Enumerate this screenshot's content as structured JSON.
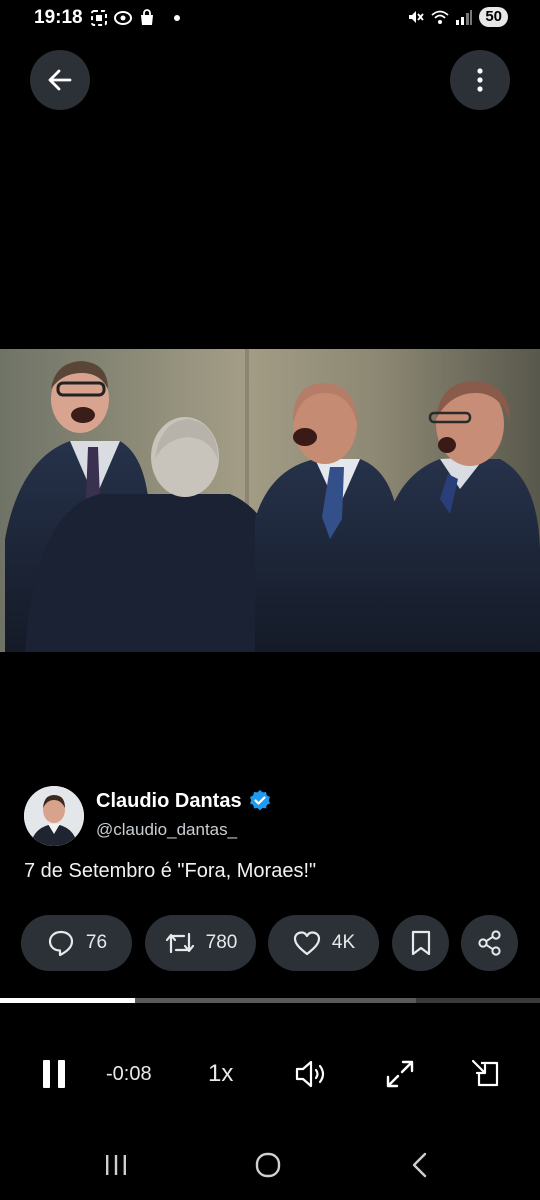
{
  "status_bar": {
    "time": "19:18",
    "battery": "50"
  },
  "top_bar": {
    "back_icon": "arrow-left-icon",
    "more_icon": "more-vertical-icon"
  },
  "media": {
    "description_icon": "video-frame"
  },
  "tweet": {
    "author_name": "Claudio Dantas",
    "handle": "@claudio_dantas_",
    "verified": true,
    "text": "7 de Setembro é \"Fora, Moraes!\"",
    "accent_color": "#1d9bf0"
  },
  "actions": {
    "replies": "76",
    "retweets": "780",
    "likes": "4K"
  },
  "player": {
    "progress": 0.25,
    "buffered": 0.77,
    "remaining": "-0:08",
    "speed": "1x"
  }
}
